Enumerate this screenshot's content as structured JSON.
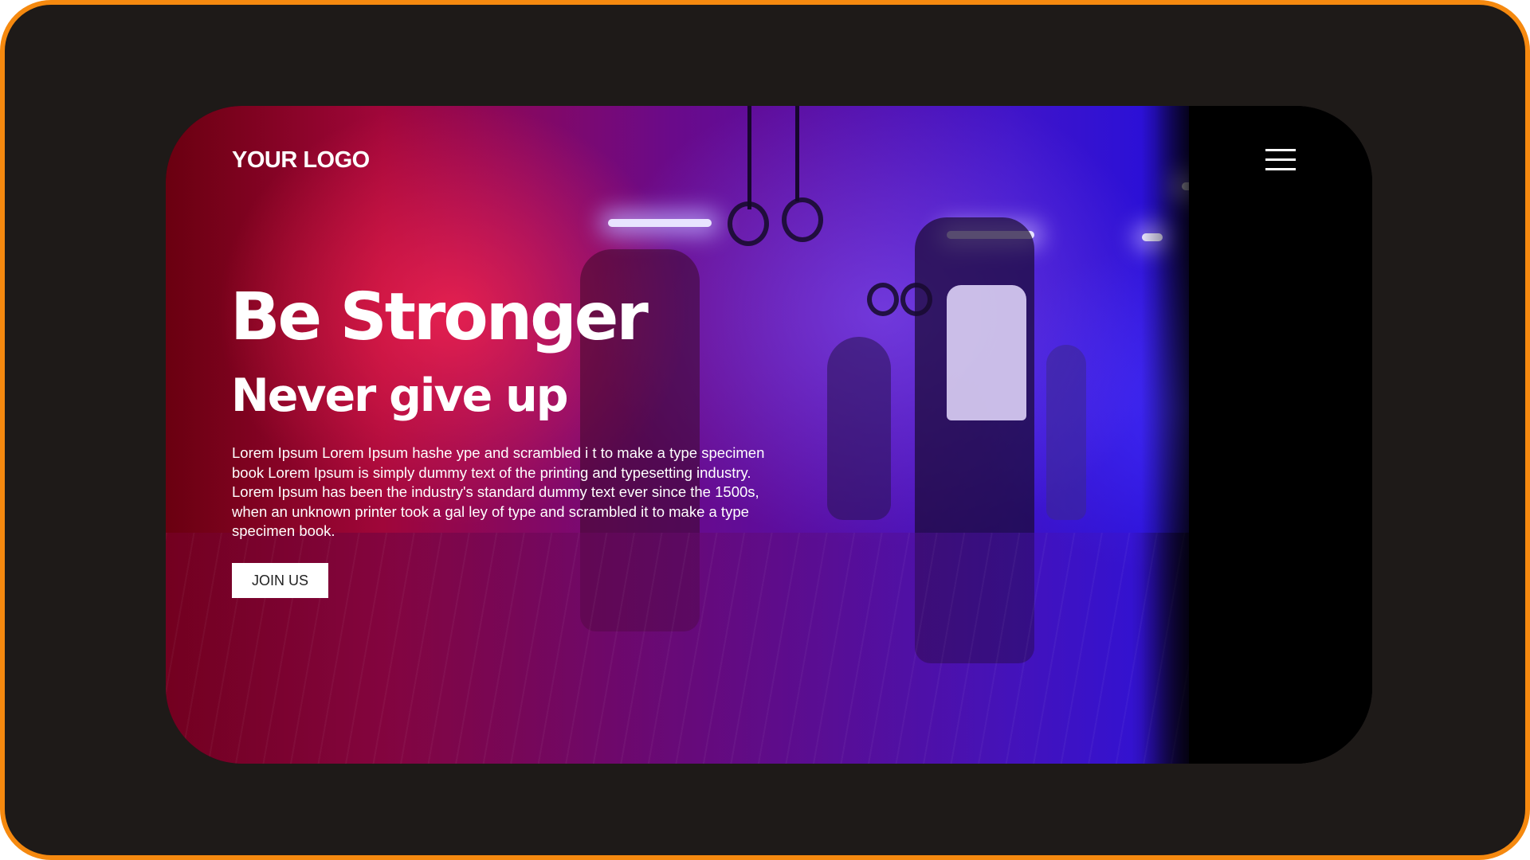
{
  "brand": {
    "logo_text": "YOUR LOGO"
  },
  "navigation": {
    "menu_icon": "hamburger-menu-icon"
  },
  "hero": {
    "headline": "Be Stronger",
    "subheadline": "Never give up",
    "body": "Lorem Ipsum Lorem Ipsum hashe ype and scrambled i t to make a type specimen book Lorem Ipsum is simply dummy text of the printing and typesetting industry. Lorem Ipsum has been the industry's standard dummy text ever since the 1500s, when an unknown printer took a gal ley of type and scrambled it to make a type specimen book.",
    "cta_label": "JOIN US"
  },
  "colors": {
    "frame_border": "#f5890f",
    "frame_background": "#1e1a18",
    "button_background": "#ffffff",
    "text": "#ffffff"
  }
}
